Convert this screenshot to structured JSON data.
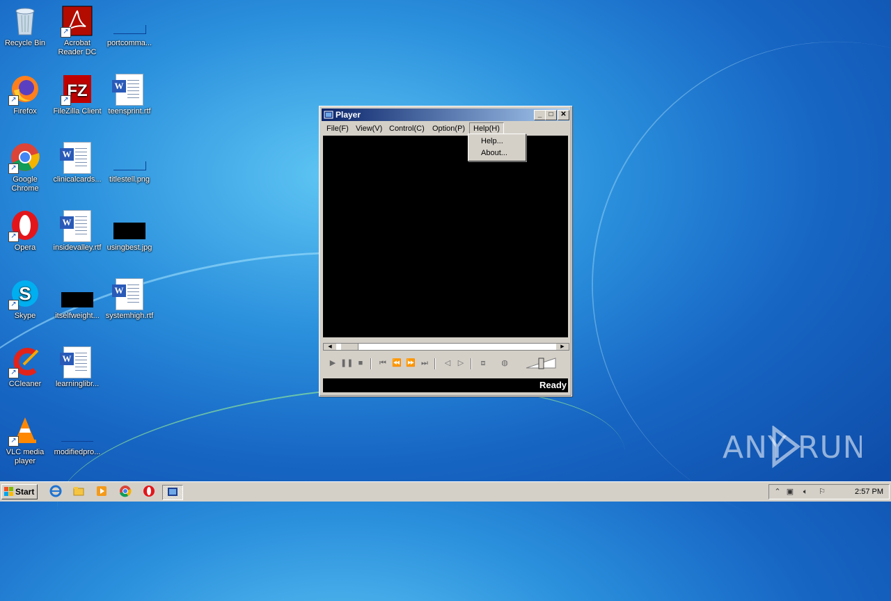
{
  "desktop": {
    "icons": [
      {
        "label": "Recycle Bin"
      },
      {
        "label": "Acrobat Reader DC"
      },
      {
        "label": "portcomma..."
      },
      {
        "label": "Firefox"
      },
      {
        "label": "FileZilla Client"
      },
      {
        "label": "teensprint.rtf"
      },
      {
        "label": "Google Chrome"
      },
      {
        "label": "clinicalcards..."
      },
      {
        "label": "titlestell.png"
      },
      {
        "label": "Opera"
      },
      {
        "label": "insidevalley.rtf"
      },
      {
        "label": "usingbest.jpg"
      },
      {
        "label": "Skype"
      },
      {
        "label": "itselfweight..."
      },
      {
        "label": "systemhigh.rtf"
      },
      {
        "label": "CCleaner"
      },
      {
        "label": "learninglibr..."
      },
      {
        "label": "VLC media player"
      },
      {
        "label": "modifiedpro..."
      }
    ]
  },
  "player": {
    "title": "Player",
    "menu": [
      "File(F)",
      "View(V)",
      "Control(C)",
      "Option(P)",
      "Help(H)"
    ],
    "help_menu": [
      "Help...",
      "About..."
    ],
    "status": "Ready"
  },
  "watermark": "ANY RUN",
  "taskbar": {
    "start_label": "Start",
    "clock": "2:57 PM"
  },
  "colors": {
    "titlebar_start": "#0a246a",
    "titlebar_end": "#a6caf0",
    "chrome": "#d4d0c8"
  }
}
